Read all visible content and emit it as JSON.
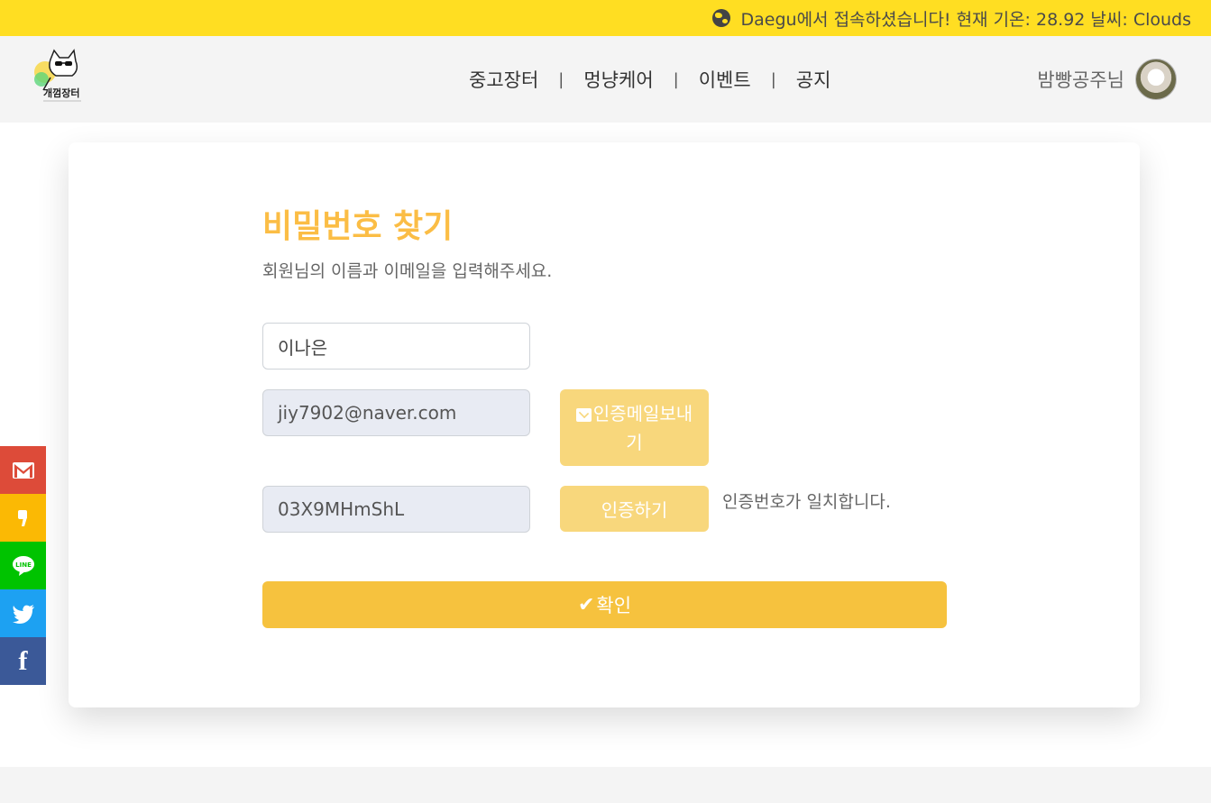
{
  "topbar": {
    "weather_text": "Daegu에서 접속하셨습니다! 현재 기온: 28.92 날씨: Clouds",
    "globe_icon": "globe-icon"
  },
  "header": {
    "logo_text": "개껌장터",
    "nav": [
      {
        "label": "중고장터"
      },
      {
        "label": "멍냥케어"
      },
      {
        "label": "이벤트"
      },
      {
        "label": "공지"
      }
    ],
    "separator": "|",
    "user_name": "밤빵공주님"
  },
  "form": {
    "title": "비밀번호 찾기",
    "subtitle": "회원님의 이름과 이메일을 입력해주세요.",
    "name_value": "이나은",
    "email_value": "jiy7902@naver.com",
    "code_value": "03X9MHmShL",
    "send_email_label": "인증메일보내기",
    "verify_label": "인증하기",
    "match_message": "인증번호가 일치합니다.",
    "confirm_label": "확인"
  },
  "share": {
    "icons": [
      "gmail-icon",
      "kakao-icon",
      "line-icon",
      "twitter-icon",
      "facebook-icon"
    ],
    "line_text": "LINE",
    "facebook_text": "f"
  },
  "colors": {
    "topbar": "#ffde22",
    "title": "#fbbd45",
    "button_light": "#f8d77c",
    "button_confirm": "#f6c23e",
    "gmail": "#dd4b39",
    "kakao": "#fbb904",
    "line": "#00c300",
    "twitter": "#1da1f2",
    "facebook": "#3b5998"
  }
}
